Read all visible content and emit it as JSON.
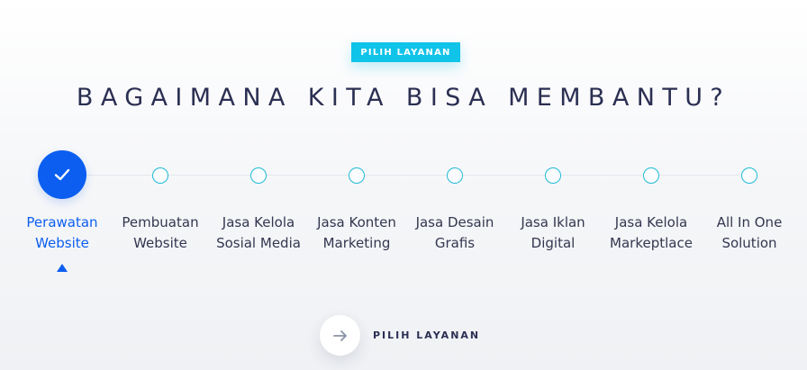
{
  "section": {
    "badge": "PILIH LAYANAN",
    "title": "BAGAIMANA KITA BISA MEMBANTU?"
  },
  "steps": [
    {
      "line1": "Perawatan",
      "line2": "Website",
      "active": true
    },
    {
      "line1": "Pembuatan",
      "line2": "Website",
      "active": false
    },
    {
      "line1": "Jasa Kelola",
      "line2": "Sosial Media",
      "active": false
    },
    {
      "line1": "Jasa Konten",
      "line2": "Marketing",
      "active": false
    },
    {
      "line1": "Jasa Desain",
      "line2": "Grafis",
      "active": false
    },
    {
      "line1": "Jasa Iklan",
      "line2": "Digital",
      "active": false
    },
    {
      "line1": "Jasa Kelola",
      "line2": "Markeptlace",
      "active": false
    },
    {
      "line1": "All In One",
      "line2": "Solution",
      "active": false
    }
  ],
  "icons": {
    "active_step": "check-icon",
    "active_pointer": "caret-up-icon",
    "cta": "arrow-right-icon"
  },
  "cta": {
    "label": "PILIH LAYANAN"
  },
  "colors": {
    "accent_blue": "#0b5ef0",
    "badge_cyan": "#10c3e8",
    "node_outline": "#1fbad6",
    "heading_text": "#2b2f52"
  }
}
